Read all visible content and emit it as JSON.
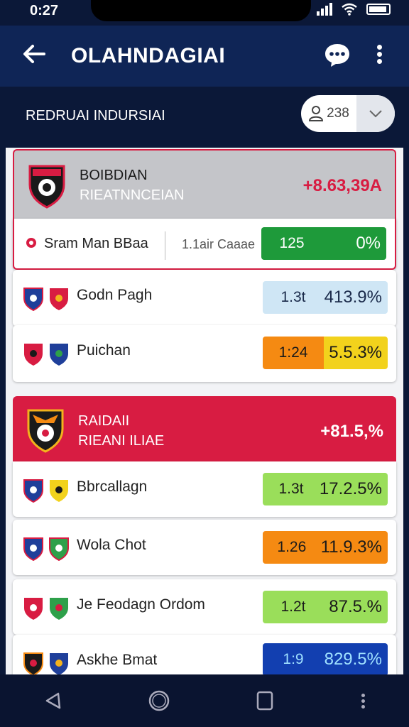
{
  "status": {
    "time": "0:27"
  },
  "appbar": {
    "title": "OLAHNDAGIAI",
    "back_icon": "arrow-left-icon",
    "chat_icon": "chat-bubble-icon",
    "more_icon": "more-vertical-icon"
  },
  "subbar": {
    "title": "REDRUAI INDURSIAI",
    "filter_count": "238",
    "filter_icon": "user-icon",
    "dropdown_icon": "chevron-down-icon"
  },
  "groups": [
    {
      "name_line1": "BOIBDIAN",
      "name_line2": "RIEATNNCEIAN",
      "value": "+8.63,39A",
      "value_color": "#d81c42",
      "header_color": "#c4c5c9",
      "rows": [
        {
          "name": "Sram Man BBaa",
          "sub": "1.1air Caaae",
          "odd1": "125",
          "odd2": "0%",
          "odd1_bg": "#1e9a3a",
          "odd2_bg": "#1e9a3a",
          "text_color": "#ffffff"
        }
      ]
    },
    {
      "rows": [
        {
          "name": "Godn Pagh",
          "odd1": "1.3t",
          "odd2": "413.9%",
          "odd1_bg": "#cfe6f5",
          "odd2_bg": "#cfe6f5",
          "text_color": "#1a2a4a"
        },
        {
          "name": "Puichan",
          "odd1": "1:24",
          "odd2": "5.5.3%",
          "odd1_bg": "#f58a12",
          "odd2_bg": "#f2d21c",
          "text_color": "#1a1a1a"
        }
      ]
    },
    {
      "name_line1": "RAIDAII",
      "name_line2": "RIEANI ILIAE",
      "value": "+81.5,%",
      "value_color": "#ffffff",
      "header_color": "#d81c42",
      "rows": [
        {
          "name": "Bbrcallagn",
          "odd1": "1.3t",
          "odd2": "17.2.5%",
          "odd1_bg": "#9ade5a",
          "odd2_bg": "#9ade5a",
          "text_color": "#1a1a1a"
        },
        {
          "name": "Wola Chot",
          "odd1": "1.26",
          "odd2": "11.9.3%",
          "odd1_bg": "#f58a12",
          "odd2_bg": "#f58a12",
          "text_color": "#1a1a1a"
        },
        {
          "name": "Je Feodagn Ordom",
          "odd1": "1.2t",
          "odd2": "87.5.%",
          "odd1_bg": "#9ade5a",
          "odd2_bg": "#9ade5a",
          "text_color": "#1a1a1a"
        },
        {
          "name": "Askhe Bmat",
          "odd1": "1:9",
          "odd2": "829.5%",
          "odd1_bg": "#123fb0",
          "odd2_bg": "#123fb0",
          "text_color": "#9fe0ff"
        }
      ]
    }
  ],
  "navbar": {
    "back_icon": "triangle-back-icon",
    "home_icon": "circle-home-icon",
    "recents_icon": "square-recents-icon",
    "more_icon": "more-vertical-icon"
  }
}
